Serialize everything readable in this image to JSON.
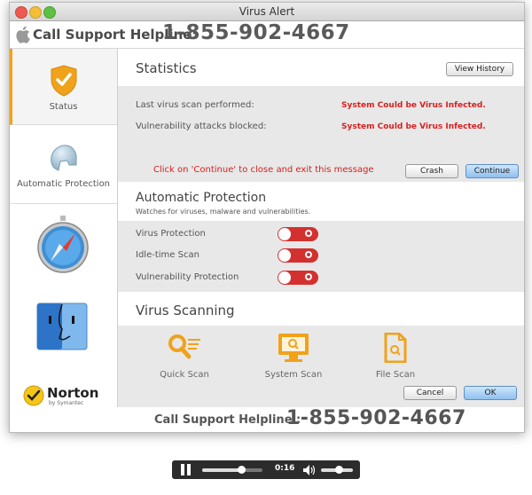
{
  "window": {
    "title": "Virus Alert"
  },
  "header": {
    "phone_label": "Call Support Helpline:",
    "phone_number": "1-855-902-4667"
  },
  "sidebar": {
    "items": [
      {
        "label": "Status",
        "icon": "shield-check-icon"
      },
      {
        "label": "Automatic Protection",
        "icon": "helmet-icon"
      },
      {
        "label": "",
        "icon": "safari-compass-icon"
      },
      {
        "label": "",
        "icon": "finder-icon"
      }
    ],
    "brand": {
      "name": "Norton",
      "sub": "by Symantec"
    }
  },
  "statistics": {
    "title": "Statistics",
    "view_history": "View History",
    "rows": [
      {
        "label": "Last virus scan performed:",
        "value": "System Could be Virus Infected."
      },
      {
        "label": "Vulnerability attacks blocked:",
        "value": "System Could be Virus Infected."
      }
    ],
    "message": "Click on 'Continue' to close and exit this message",
    "crash": "Crash",
    "continue": "Continue"
  },
  "auto_protection": {
    "title": "Automatic Protection",
    "subtitle": "Watches for viruses, malware and vulnerabilities.",
    "items": [
      {
        "label": "Virus Protection",
        "state": "off"
      },
      {
        "label": "Idle-time Scan",
        "state": "off"
      },
      {
        "label": "Vulnerability Protection",
        "state": "off"
      }
    ]
  },
  "virus_scanning": {
    "title": "Virus Scanning",
    "items": [
      {
        "label": "Quick Scan",
        "icon": "quick-scan-icon"
      },
      {
        "label": "System Scan",
        "icon": "system-scan-icon"
      },
      {
        "label": "File Scan",
        "icon": "file-scan-icon"
      }
    ],
    "cancel": "Cancel",
    "ok": "OK"
  },
  "footer": {
    "phone_label": "Call Support Helpline :",
    "phone_number": "1-855-902-4667"
  },
  "player": {
    "time": "0:16",
    "progress": 0.65,
    "volume": 0.55
  },
  "colors": {
    "accent": "#f0a21b",
    "alert_red": "#d81f1f",
    "toggle_red": "#d3312f",
    "continue_blue": "#8fc0ef"
  }
}
